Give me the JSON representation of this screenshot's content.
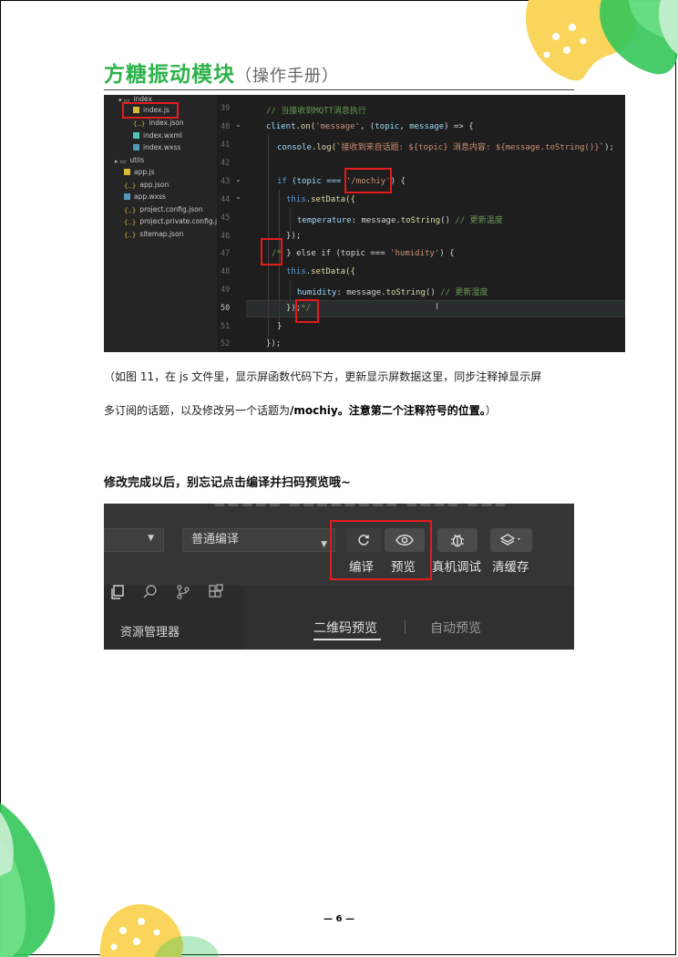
{
  "header": {
    "title": "方糖振动模块",
    "subtitle": "（操作手册）"
  },
  "code_screenshot": {
    "file_tree": [
      {
        "label": "index",
        "icon": "folder-open-icon"
      },
      {
        "label": "index.js",
        "icon": "js-file-icon"
      },
      {
        "label": "index.json",
        "icon": "json-file-icon"
      },
      {
        "label": "index.wxml",
        "icon": "wxml-file-icon"
      },
      {
        "label": "index.wxss",
        "icon": "wxss-file-icon"
      },
      {
        "label": "utils",
        "icon": "folder-icon"
      },
      {
        "label": "app.js",
        "icon": "js-file-icon"
      },
      {
        "label": "app.json",
        "icon": "json-file-icon"
      },
      {
        "label": "app.wxss",
        "icon": "wxss-file-icon"
      },
      {
        "label": "project.config.json",
        "icon": "json-file-icon"
      },
      {
        "label": "project.private.config.js...",
        "icon": "json-file-icon"
      },
      {
        "label": "sitemap.json",
        "icon": "json-file-icon"
      }
    ],
    "line_numbers": [
      "39",
      "40",
      "41",
      "42",
      "43",
      "44",
      "45",
      "46",
      "47",
      "48",
      "49",
      "50",
      "51",
      "52"
    ],
    "code": {
      "l39": "// 当接收到MQTT消息执行",
      "l40_a": "client",
      "l40_b": ".on(",
      "l40_c": "'message'",
      "l40_d": ", (",
      "l40_e": "topic",
      "l40_f": ", ",
      "l40_g": "message",
      "l40_h": ") => {",
      "l41_a": "console",
      "l41_b": ".log(`",
      "l41_c": "接收到来自话题: ${topic} 消息内容: ${message.toString()}",
      "l41_d": "`);",
      "l43_a": "if",
      "l43_b": " (topic === ",
      "l43_c": "'/mochiy'",
      "l43_d": ") {",
      "l44_a": "this",
      "l44_b": ".setData({",
      "l45_a": "temperature",
      "l45_b": ": message.",
      "l45_c": "toString",
      "l45_d": "() ",
      "l45_e": "// 更新温度",
      "l46": "});",
      "l47_a": "/*",
      "l47_b": " } else if (topic === ",
      "l47_c": "'humidity'",
      "l47_d": ") {",
      "l48_a": "this",
      "l48_b": ".setData({",
      "l49_a": "humidity",
      "l49_b": ": message.",
      "l49_c": "toString",
      "l49_d": "() ",
      "l49_e": "// 更新湿度",
      "l50_a": "});",
      "l50_b": "*/",
      "l51": "}",
      "l52": "});"
    }
  },
  "body": {
    "para1": "（如图 11，在 js 文件里，显示屏函数代码下方，更新显示屏数据这里，同步注释掉显示屏",
    "para2_normal": "多订阅的话题，以及修改另一个话题为",
    "para2_bold": "/mochiy。注意第二个注释符号的位置。",
    "para2_end": "）",
    "heading": "修改完成以后，别忘记点击编译并扫码预览哦~"
  },
  "toolbar_screenshot": {
    "compile_mode": "普通编译",
    "buttons": [
      {
        "label": "编译",
        "icon": "refresh-icon"
      },
      {
        "label": "预览",
        "icon": "eye-icon"
      },
      {
        "label": "真机调试",
        "icon": "bug-icon"
      },
      {
        "label": "清缓存",
        "icon": "layers-icon"
      }
    ],
    "activity_icons": [
      "copy-icon",
      "search-icon",
      "source-control-icon",
      "extensions-icon"
    ],
    "explorer_label": "资源管理器",
    "tabs": {
      "qr_preview": "二维码预览",
      "auto_preview": "自动预览"
    }
  },
  "footer": {
    "page_number": "— 6 —"
  },
  "colors": {
    "title_green": "#2eb34c",
    "highlight_red": "#e31c1c",
    "deco_green": "#34c759",
    "deco_yellow": "#f9d65b"
  }
}
